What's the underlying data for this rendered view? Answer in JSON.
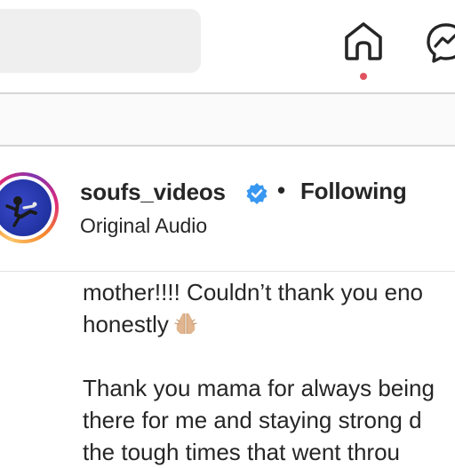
{
  "header": {
    "search": {
      "placeholder": ""
    },
    "icons": {
      "home": "home-icon",
      "messenger": "messenger-icon"
    },
    "notification_color": "#e0535f"
  },
  "post": {
    "author": {
      "username": "soufs_videos",
      "verified": true,
      "separator": "•",
      "follow_status": "Following",
      "audio_label": "Original Audio"
    },
    "caption": {
      "lines": [
        "mother!!!! Couldn’t thank you eno",
        "honestly",
        "Thank you mama for always being",
        "there for me and staying strong d",
        "the tough times that went throu"
      ],
      "emoji": "folded-hands-emoji"
    }
  },
  "colors": {
    "verified_blue": "#3897f0",
    "text": "#262626"
  }
}
